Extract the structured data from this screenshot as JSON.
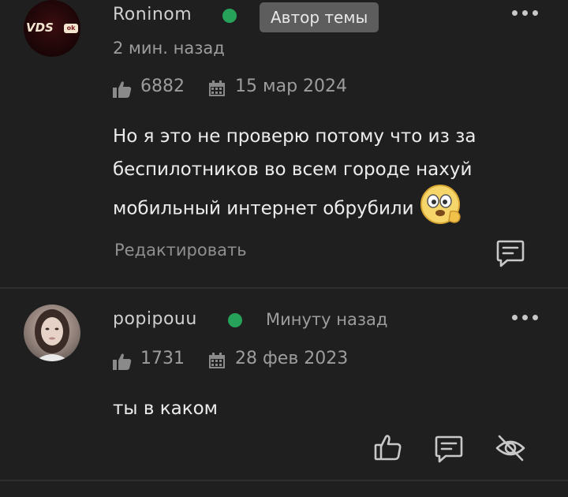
{
  "posts": [
    {
      "username": "Roninom",
      "author_badge": "Автор темы",
      "time_ago": "2 мин. назад",
      "likes": "6882",
      "date": "15 мар 2024",
      "body": "Но я это не проверю потому что из за беспилотников во всем городе нахуй мобильный интернет обрубили",
      "avatar_logo_text": "VDS",
      "avatar_logo_badge": "ok",
      "edit_label": "Редактировать",
      "icons": {
        "more": "more-dots-icon",
        "like": "thumb-up-icon",
        "calendar": "calendar-icon",
        "emoji": "shocked-face-emoji-icon",
        "reply": "reply-bubble-icon"
      }
    },
    {
      "username": "popipouu",
      "time_ago": "Минуту назад",
      "likes": "1731",
      "date": "28 фев 2023",
      "body": "ты в каком",
      "icons": {
        "more": "more-dots-icon",
        "like": "thumb-up-icon",
        "calendar": "calendar-icon",
        "like_action": "like-outline-icon",
        "reply": "reply-bubble-icon",
        "hide": "eye-off-icon"
      }
    }
  ],
  "colors": {
    "background": "#1f1f1f",
    "online": "#27a25a",
    "badge_bg": "#5d5d5d",
    "muted_text": "#9d9d9d",
    "separator": "#2e2e2e"
  }
}
